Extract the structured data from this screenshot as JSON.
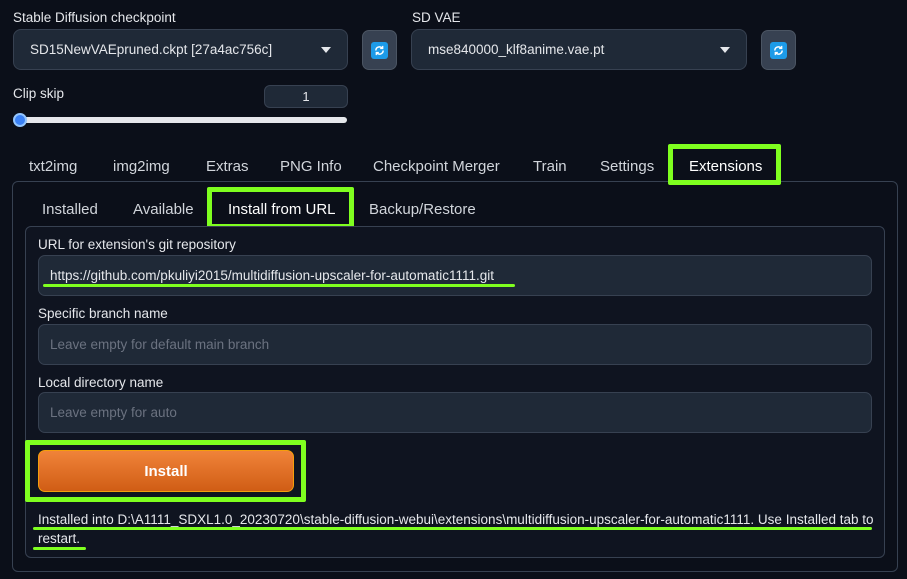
{
  "settings": {
    "checkpoint_label": "Stable Diffusion checkpoint",
    "checkpoint_value": "SD15NewVAEpruned.ckpt [27a4ac756c]",
    "vae_label": "SD VAE",
    "vae_value": "mse840000_klf8anime.vae.pt",
    "clip_skip_label": "Clip skip",
    "clip_skip_value": "1",
    "clip_skip_slider_fraction": 0
  },
  "main_tabs": [
    "txt2img",
    "img2img",
    "Extras",
    "PNG Info",
    "Checkpoint Merger",
    "Train",
    "Settings",
    "Extensions"
  ],
  "main_tabs_selected": "Extensions",
  "sub_tabs": [
    "Installed",
    "Available",
    "Install from URL",
    "Backup/Restore"
  ],
  "sub_tabs_selected": "Install from URL",
  "form": {
    "url_label": "URL for extension's git repository",
    "url_value": "https://github.com/pkuliyi2015/multidiffusion-upscaler-for-automatic1111.git",
    "branch_label": "Specific branch name",
    "branch_placeholder": "Leave empty for default main branch",
    "dir_label": "Local directory name",
    "dir_placeholder": "Leave empty for auto",
    "install_label": "Install",
    "result_text": "Installed into D:\\A1111_SDXL1.0_20230720\\stable-diffusion-webui\\extensions\\multidiffusion-upscaler-for-automatic1111. Use Installed tab to restart."
  },
  "colors": {
    "background": "#0b0f19",
    "highlight": "#7fff1f",
    "install_button": "#e0702a",
    "slider_accent": "#3b82f6"
  }
}
